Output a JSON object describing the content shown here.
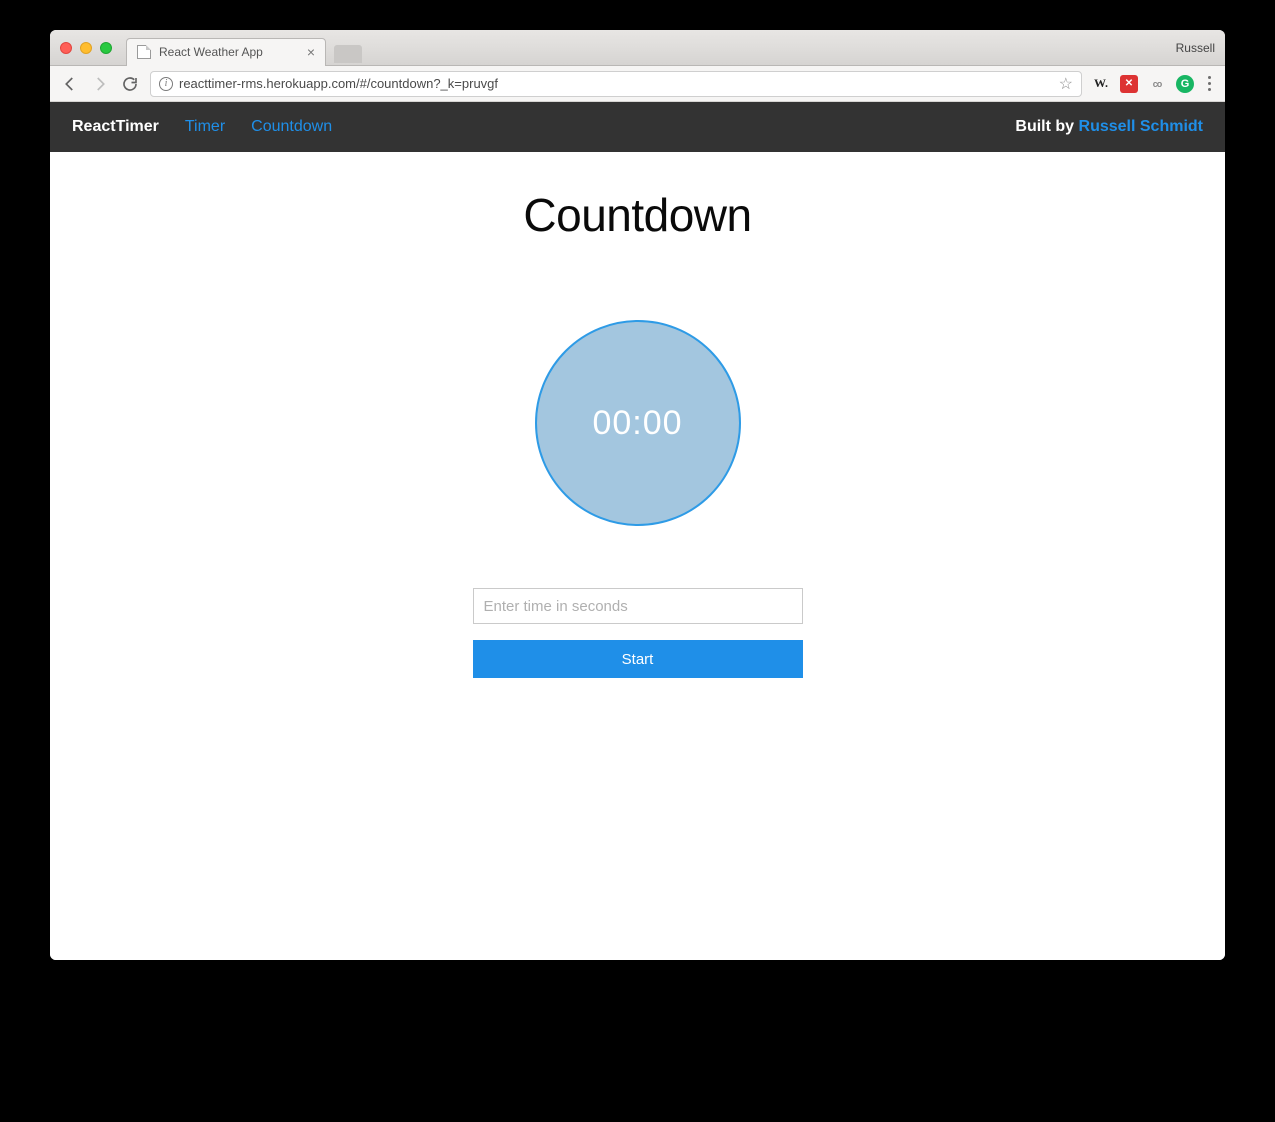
{
  "browser": {
    "tab_title": "React Weather App",
    "profile_name": "Russell",
    "url": "reacttimer-rms.herokuapp.com/#/countdown?_k=pruvgf"
  },
  "nav": {
    "brand": "ReactTimer",
    "links": {
      "timer": "Timer",
      "countdown": "Countdown"
    },
    "built_by_prefix": "Built by ",
    "author": "Russell Schmidt"
  },
  "page": {
    "title": "Countdown",
    "clock_time": "00:00",
    "input_placeholder": "Enter time in seconds",
    "start_label": "Start"
  }
}
